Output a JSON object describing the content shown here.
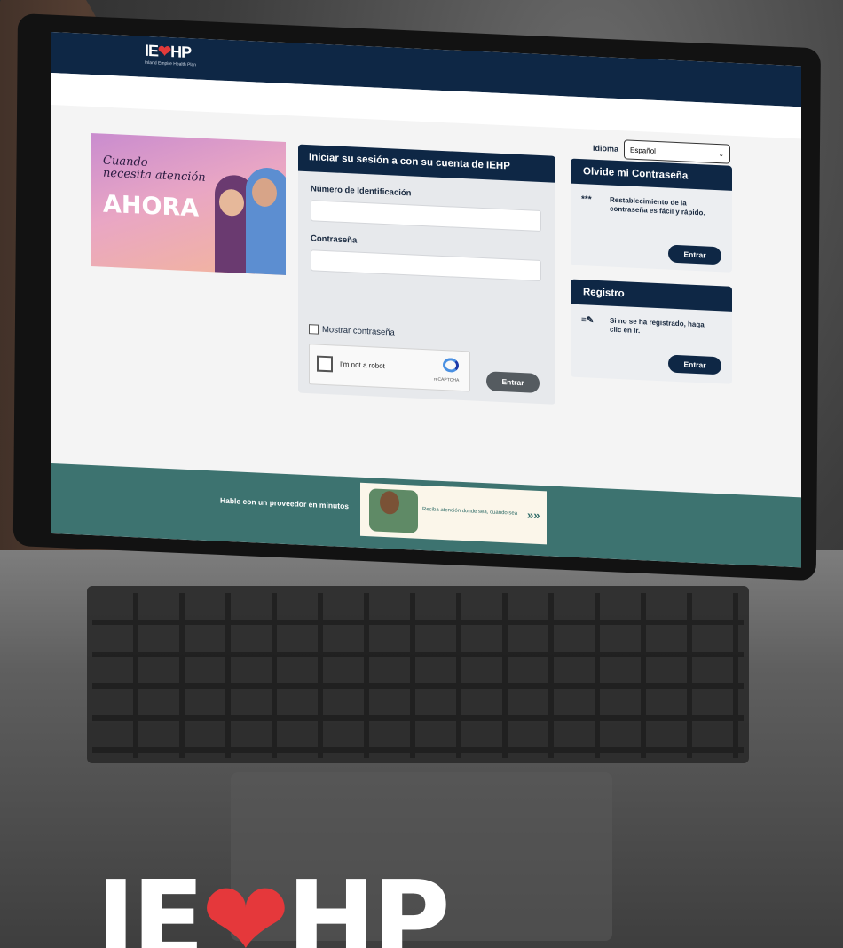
{
  "header": {
    "logo_text": "IE",
    "logo_text2": "HP",
    "logo_heart": "❤",
    "logo_subtitle": "Inland Empire Health Plan"
  },
  "language": {
    "label": "Idioma",
    "selected": "Español",
    "chevron": "⌄"
  },
  "promo": {
    "line1": "Cuando",
    "line2": "necesita atención",
    "big": "AHORA"
  },
  "login": {
    "title": "Iniciar su sesión a con su cuenta de IEHP",
    "id_label": "Número de Identificación",
    "password_label": "Contraseña",
    "show_password": "Mostrar contraseña",
    "captcha_text": "I'm not a robot",
    "captcha_brand": "reCAPTCHA",
    "submit": "Entrar"
  },
  "forgot": {
    "title": "Olvide mi Contraseña",
    "icon": "***",
    "text": "Restablecimiento de la contraseña es fácil y rápido.",
    "button": "Entrar"
  },
  "register": {
    "title": "Registro",
    "icon": "≡✎",
    "text": "Si no se ha registrado, haga clic en Ir.",
    "button": "Entrar"
  },
  "footer": {
    "left": "Hable con un proveedor en minutos",
    "right": "Reciba atención donde sea, cuando sea",
    "arrows": "»»"
  },
  "bottom_logo": {
    "left": "IE",
    "heart": "❤",
    "right": "HP"
  },
  "colors": {
    "navy": "#0e2745",
    "teal": "#3d7370",
    "red": "#e23a3a"
  }
}
